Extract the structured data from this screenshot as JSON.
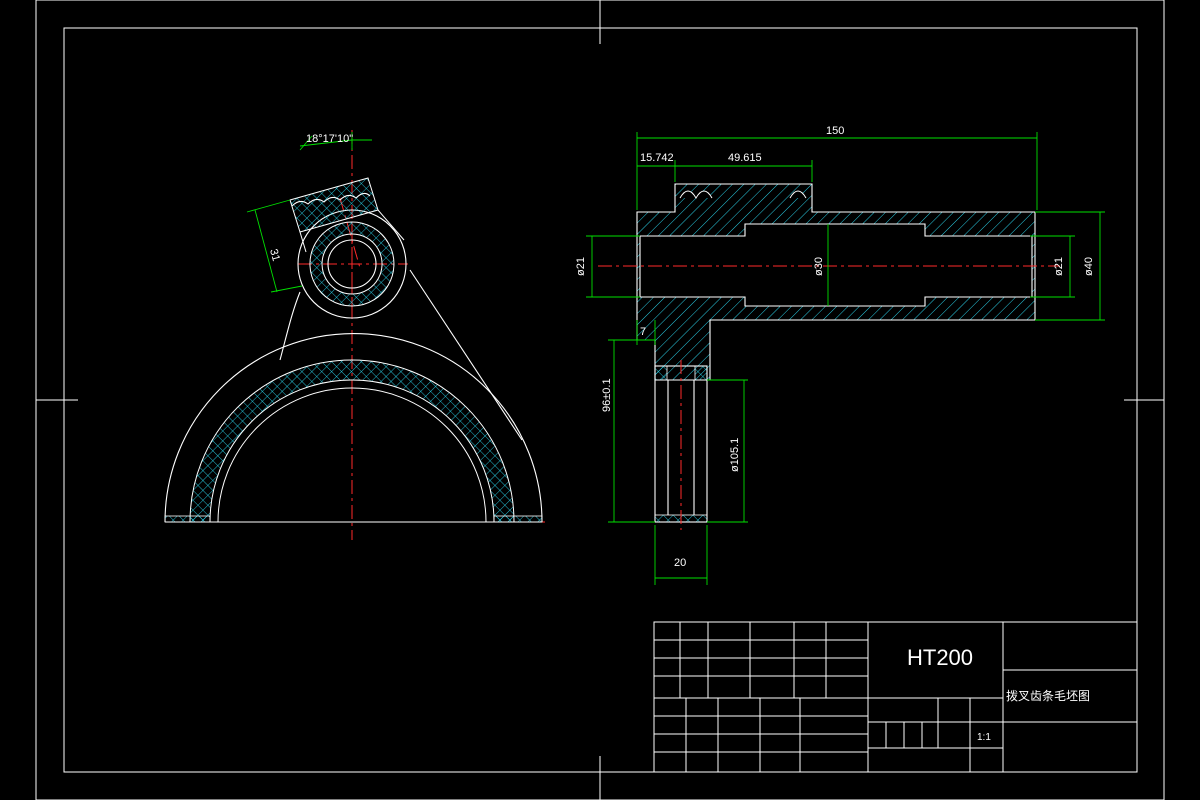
{
  "drawing": {
    "colors": {
      "outline": "#ffffff",
      "center": "#ff2a2a",
      "dimension": "#00e000",
      "hatch": "#2ee6ff"
    },
    "front_view": {
      "angle_label": "18°17'10\"",
      "length_label": "31"
    },
    "side_view": {
      "dim_total": "150",
      "dim_a": "15.742",
      "dim_b": "49.615",
      "dia_left": "ø21",
      "dia_mid": "ø30",
      "dia_right": "ø21",
      "dia_outer": "ø40",
      "dim_7": "7",
      "dim_height": "96±0.1",
      "dia_fork": "ø105.1",
      "dim_20": "20"
    },
    "title_block": {
      "material": "HT200",
      "part_name": "拨叉齿条毛坯图",
      "scale": "1:1"
    }
  }
}
